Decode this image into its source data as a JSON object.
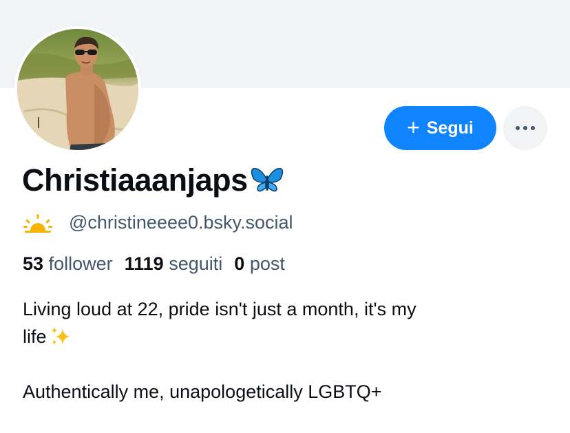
{
  "profile": {
    "display_name": "Christiaaanjaps",
    "name_emoji": "butterfly-icon",
    "status_emoji": "sunrise-icon",
    "handle": "@christineeee0.bsky.social",
    "stats": {
      "followers_count": "53",
      "followers_label": "follower",
      "following_count": "1119",
      "following_label": "seguiti",
      "posts_count": "0",
      "posts_label": "post"
    },
    "bio": {
      "line1": "Living loud at 22, pride isn't just a month, it's my",
      "line2": "life",
      "line2_emoji": "sparkles-icon",
      "line3": "Authentically me, unapologetically LGBTQ+"
    }
  },
  "actions": {
    "follow_label": "Segui",
    "follow_icon": "plus-icon",
    "more_icon": "ellipsis-icon"
  },
  "colors": {
    "accent": "#1083fe",
    "banner": "#f1f3f5",
    "text_primary": "#0b0f14",
    "text_secondary": "#42576c"
  }
}
